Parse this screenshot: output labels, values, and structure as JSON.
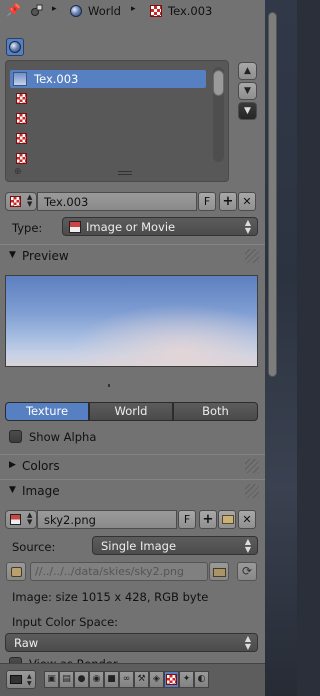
{
  "breadcrumb": {
    "world_label": "World",
    "texture_label": "Tex.003",
    "pin_icon": "pin-icon",
    "context_icon": "texture-context-icon"
  },
  "texture_slots": [
    {
      "label": "Tex.003",
      "active": true
    },
    {
      "label": "",
      "active": false
    },
    {
      "label": "",
      "active": false
    },
    {
      "label": "",
      "active": false
    },
    {
      "label": "",
      "active": false
    }
  ],
  "slot_controls": {
    "up": "▲",
    "down": "▼",
    "menu": "▼",
    "add": "⊕"
  },
  "datablock": {
    "name": "Tex.003",
    "fake_user": "F",
    "new": "+",
    "unlink": "✕"
  },
  "type_row": {
    "label": "Type:",
    "value": "Image or Movie"
  },
  "preview_section": {
    "title": "Preview",
    "expanded": true,
    "tabs": [
      "Texture",
      "World",
      "Both"
    ],
    "selected_tab": "Texture",
    "show_alpha_label": "Show Alpha",
    "show_alpha": false
  },
  "colors_section": {
    "title": "Colors",
    "expanded": false
  },
  "image_section": {
    "title": "Image",
    "expanded": true,
    "image_name": "sky2.png",
    "fake_user": "F",
    "source_label": "Source:",
    "source_value": "Single Image",
    "filepath": "//../../../data/skies/sky2.png",
    "info": "Image: size 1015 x 428, RGB byte",
    "color_space_label": "Input Color Space:",
    "color_space_value": "Raw",
    "view_as_render_label": "View as Render"
  },
  "colors": {
    "accent": "#5680c2",
    "panel": "#727272"
  }
}
